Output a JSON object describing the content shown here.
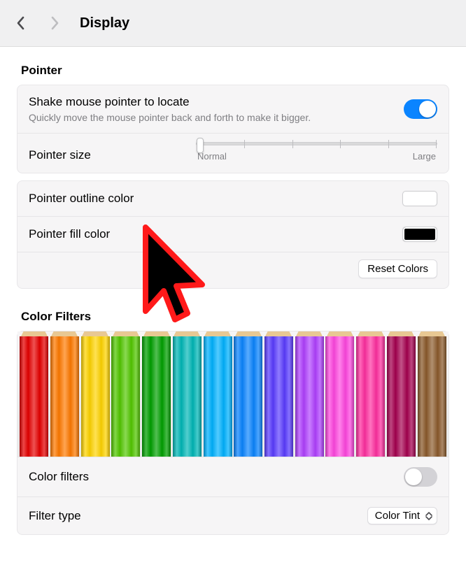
{
  "window": {
    "title": "Display"
  },
  "pointer": {
    "section_label": "Pointer",
    "shake": {
      "title": "Shake mouse pointer to locate",
      "subtitle": "Quickly move the mouse pointer back and forth to make it bigger.",
      "on": true
    },
    "size": {
      "label": "Pointer size",
      "min_label": "Normal",
      "max_label": "Large",
      "value_pct": 0
    },
    "outline": {
      "label": "Pointer outline color",
      "color": "#ffffff"
    },
    "fill": {
      "label": "Pointer fill color",
      "color": "#000000"
    },
    "reset_label": "Reset Colors"
  },
  "color_filters": {
    "section_label": "Color Filters",
    "pencil_colors": [
      "#e60000",
      "#ff7a00",
      "#ffd400",
      "#52c700",
      "#00a000",
      "#00b7b7",
      "#00b2ff",
      "#0a84ff",
      "#5a3cff",
      "#b040ff",
      "#ff46e0",
      "#ff2fa0",
      "#a5004f",
      "#8b5a2b"
    ],
    "enabled": {
      "label": "Color filters",
      "on": false
    },
    "filter_type": {
      "label": "Filter type",
      "value": "Color Tint"
    }
  }
}
